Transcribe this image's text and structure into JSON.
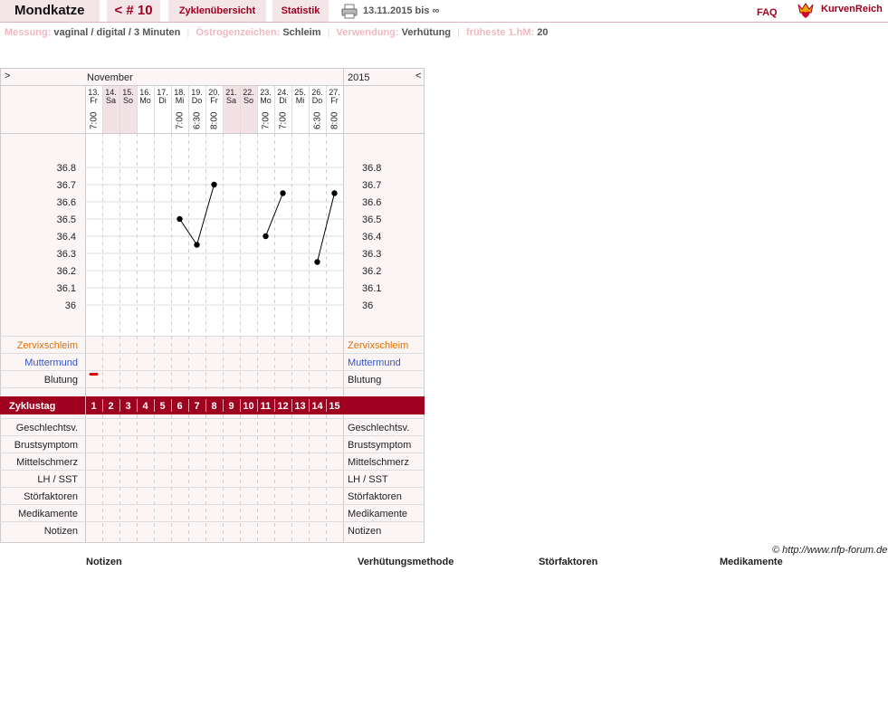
{
  "header": {
    "brand": "Mondkatze",
    "cycle": "< # 10",
    "tabs": [
      "Zyklenübersicht",
      "Statistik"
    ],
    "range": "13.11.2015 bis ∞",
    "faq": "FAQ",
    "logo_text": "KurvenReich",
    "print_icon": "printer-icon",
    "logo_icon": "crown-heart-icon"
  },
  "info": [
    {
      "label": "Messung:",
      "value": "vaginal / digital / 3 Minuten"
    },
    {
      "label": "Östrogenzeichen:",
      "value": "Schleim"
    },
    {
      "label": "Verwendung:",
      "value": "Verhütung"
    },
    {
      "label": "früheste 1.hM:",
      "value": "20"
    }
  ],
  "chart_data": {
    "type": "line",
    "nav_left": ">",
    "nav_right": "<",
    "month": "November",
    "year": "2015",
    "days": [
      {
        "date": "13.",
        "weekday": "Fr",
        "time": "7:00",
        "temp": null,
        "cycle_day": 1,
        "weekend": false
      },
      {
        "date": "14.",
        "weekday": "Sa",
        "time": "",
        "temp": null,
        "cycle_day": 2,
        "weekend": true
      },
      {
        "date": "15.",
        "weekday": "So",
        "time": "",
        "temp": null,
        "cycle_day": 3,
        "weekend": true
      },
      {
        "date": "16.",
        "weekday": "Mo",
        "time": "",
        "temp": null,
        "cycle_day": 4,
        "weekend": false
      },
      {
        "date": "17.",
        "weekday": "Di",
        "time": "",
        "temp": null,
        "cycle_day": 5,
        "weekend": false
      },
      {
        "date": "18.",
        "weekday": "Mi",
        "time": "7:00",
        "temp": 36.5,
        "cycle_day": 6,
        "weekend": false
      },
      {
        "date": "19.",
        "weekday": "Do",
        "time": "6:30",
        "temp": 36.35,
        "cycle_day": 7,
        "weekend": false
      },
      {
        "date": "20.",
        "weekday": "Fr",
        "time": "8:00",
        "temp": 36.7,
        "cycle_day": 8,
        "weekend": false
      },
      {
        "date": "21.",
        "weekday": "Sa",
        "time": "",
        "temp": null,
        "cycle_day": 9,
        "weekend": true
      },
      {
        "date": "22.",
        "weekday": "So",
        "time": "",
        "temp": null,
        "cycle_day": 10,
        "weekend": true
      },
      {
        "date": "23.",
        "weekday": "Mo",
        "time": "7:00",
        "temp": 36.4,
        "cycle_day": 11,
        "weekend": false
      },
      {
        "date": "24.",
        "weekday": "Di",
        "time": "7:00",
        "temp": 36.65,
        "cycle_day": 12,
        "weekend": false
      },
      {
        "date": "25.",
        "weekday": "Mi",
        "time": "",
        "temp": null,
        "cycle_day": 13,
        "weekend": false
      },
      {
        "date": "26.",
        "weekday": "Do",
        "time": "6:30",
        "temp": 36.25,
        "cycle_day": 14,
        "weekend": false
      },
      {
        "date": "27.",
        "weekday": "Fr",
        "time": "8:00",
        "temp": 36.65,
        "cycle_day": 15,
        "weekend": false
      }
    ],
    "ylim": [
      36.0,
      36.8
    ],
    "yticks": [
      "36.8",
      "36.7",
      "36.6",
      "36.5",
      "36.4",
      "36.3",
      "36.2",
      "36.1",
      "36"
    ],
    "segments": [
      [
        5,
        6,
        7
      ],
      [
        10,
        11
      ],
      [
        13,
        14
      ]
    ],
    "bleeding_days": [
      1
    ],
    "rows_top": [
      "Zervixschleim",
      "Muttermund",
      "Blutung"
    ],
    "cycle_label": "Zyklustag",
    "rows_bottom": [
      "Geschlechtsv.",
      "Brustsymptom",
      "Mittelschmerz",
      "LH / SST",
      "Störfaktoren",
      "Medikamente",
      "Notizen"
    ],
    "colors": {
      "accent": "#a0001f",
      "zervix": "#e07000",
      "muttermund": "#3355cc",
      "bleeding": "#dd0000",
      "weekend": "#f2e2e6",
      "grid": "#cccccc"
    }
  },
  "footer": {
    "credit": "© http://www.nfp-forum.de",
    "sections": [
      "Notizen",
      "Verhütungsmethode",
      "Störfaktoren",
      "Medikamente"
    ]
  }
}
